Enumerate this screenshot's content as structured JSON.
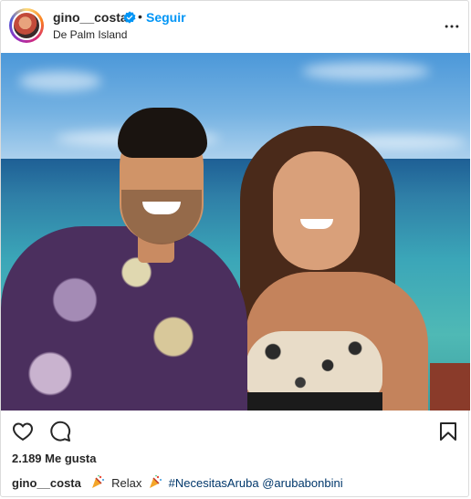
{
  "header": {
    "username": "gino__costa",
    "separator": "•",
    "follow_label": "Seguir",
    "location": "De Palm Island",
    "more_icon": "more-horizontal-icon",
    "verified_color": "#0095f6"
  },
  "photo": {
    "description_icon": "post-photo"
  },
  "actions": {
    "like_icon": "heart-icon",
    "comment_icon": "comment-icon",
    "save_icon": "bookmark-icon"
  },
  "likes": {
    "text": "2.189 Me gusta"
  },
  "caption": {
    "username": "gino__costa",
    "text": "Relax",
    "hashtag": "#NecesitasAruba",
    "mention": "@arubabonbini",
    "emoji_icon": "party-popper-icon"
  },
  "colors": {
    "link": "#00376b",
    "accent": "#0095f6",
    "text": "#262626",
    "border": "#dbdbdb"
  }
}
